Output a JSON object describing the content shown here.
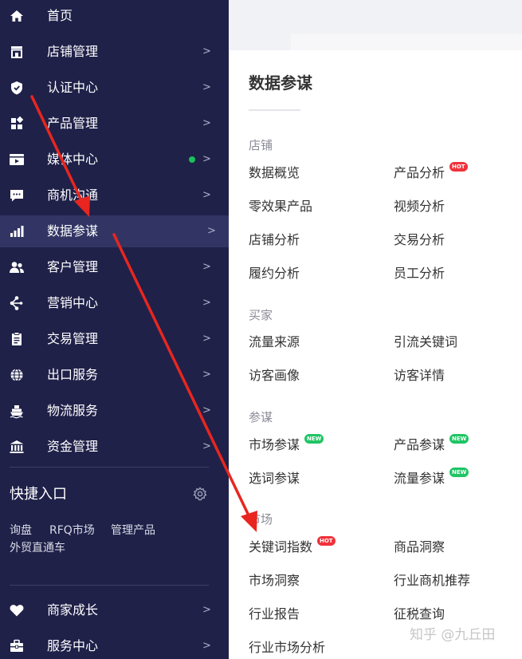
{
  "sidebar": {
    "items": [
      {
        "label": "首页",
        "icon": "home-icon"
      },
      {
        "label": "店铺管理",
        "icon": "store-icon",
        "arrow": ">"
      },
      {
        "label": "认证中心",
        "icon": "shield-icon",
        "arrow": ">"
      },
      {
        "label": "产品管理",
        "icon": "product-icon",
        "arrow": ">"
      },
      {
        "label": "媒体中心",
        "icon": "media-icon",
        "arrow": ">",
        "dot_color": "#19c15a"
      },
      {
        "label": "商机沟通",
        "icon": "chat-icon",
        "arrow": ">"
      },
      {
        "label": "数据参谋",
        "icon": "bar-chart-icon",
        "arrow": ">",
        "active": true
      },
      {
        "label": "客户管理",
        "icon": "customers-icon",
        "arrow": ">"
      },
      {
        "label": "营销中心",
        "icon": "marketing-icon",
        "arrow": ">"
      },
      {
        "label": "交易管理",
        "icon": "clipboard-icon",
        "arrow": ">"
      },
      {
        "label": "出口服务",
        "icon": "globe-icon",
        "arrow": ">"
      },
      {
        "label": "物流服务",
        "icon": "ship-icon",
        "arrow": ">"
      },
      {
        "label": "资金管理",
        "icon": "bank-icon",
        "arrow": ">"
      }
    ],
    "quick_entry": {
      "title": "快捷入口",
      "gear_icon": "gear-icon",
      "links": [
        "询盘",
        "RFQ市场",
        "管理产品",
        "外贸直通车"
      ]
    },
    "bottom_items": [
      {
        "label": "商家成长",
        "icon": "heart-icon",
        "arrow": ">"
      },
      {
        "label": "服务中心",
        "icon": "briefcase-icon",
        "arrow": ">"
      }
    ]
  },
  "panel": {
    "title": "数据参谋",
    "sections": [
      {
        "heading": "店铺",
        "links": [
          {
            "label": "数据概览"
          },
          {
            "label": "产品分析",
            "badge": "HOT"
          },
          {
            "label": "零效果产品"
          },
          {
            "label": "视频分析"
          },
          {
            "label": "店铺分析"
          },
          {
            "label": "交易分析"
          },
          {
            "label": "履约分析"
          },
          {
            "label": "员工分析"
          }
        ]
      },
      {
        "heading": "买家",
        "links": [
          {
            "label": "流量来源"
          },
          {
            "label": "引流关键词"
          },
          {
            "label": "访客画像"
          },
          {
            "label": "访客详情"
          }
        ]
      },
      {
        "heading": "参谋",
        "links": [
          {
            "label": "市场参谋",
            "badge": "NEW"
          },
          {
            "label": "产品参谋",
            "badge": "NEW"
          },
          {
            "label": "选词参谋"
          },
          {
            "label": "流量参谋",
            "badge": "NEW"
          }
        ]
      },
      {
        "heading": "市场",
        "links": [
          {
            "label": "关键词指数",
            "badge": "HOT"
          },
          {
            "label": "商品洞察"
          },
          {
            "label": "市场洞察"
          },
          {
            "label": "行业商机推荐"
          },
          {
            "label": "行业报告"
          },
          {
            "label": "征税查询"
          },
          {
            "label": "行业市场分析"
          }
        ]
      }
    ]
  },
  "watermark": "知乎 @九丘田",
  "colors": {
    "sidebar_bg": "#1f2149",
    "sidebar_active_bg": "#323564",
    "annotation_arrow": "#e8261f",
    "badge_hot": "#f0323b",
    "badge_new": "#1fc564"
  }
}
